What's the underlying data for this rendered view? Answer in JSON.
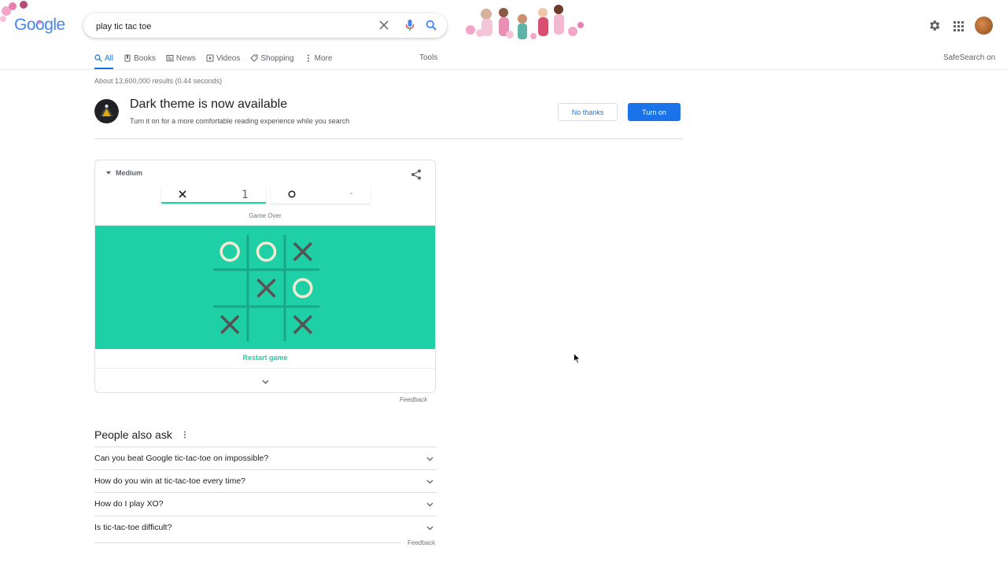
{
  "logo": {
    "text": "Google"
  },
  "search": {
    "query": "play tic tac toe"
  },
  "tabs": [
    {
      "label": "All",
      "icon": "search-icon"
    },
    {
      "label": "Books",
      "icon": "book-icon"
    },
    {
      "label": "News",
      "icon": "news-icon"
    },
    {
      "label": "Videos",
      "icon": "video-icon"
    },
    {
      "label": "Shopping",
      "icon": "tag-icon"
    },
    {
      "label": "More",
      "icon": "more-vert-icon"
    }
  ],
  "toolbar": {
    "tools_label": "Tools",
    "safesearch_label": "SafeSearch on"
  },
  "result_stats": "About 13,600,000 results (0.44 seconds)",
  "promo": {
    "title": "Dark theme is now available",
    "subtitle": "Turn it on for a more comfortable reading experience while you search",
    "no_thanks_label": "No thanks",
    "turn_on_label": "Turn on"
  },
  "game": {
    "difficulty": "Medium",
    "score_x": "1",
    "score_o": "-",
    "status": "Game Over",
    "board": [
      "O",
      "O",
      "X",
      "",
      "X",
      "O",
      "X",
      "",
      "X"
    ],
    "restart_label": "Restart game",
    "colors": {
      "board": "#1fcfa6",
      "x": "#545454",
      "o": "#f2ebd3"
    }
  },
  "feedback_label": "Feedback",
  "people_also_ask": {
    "title": "People also ask",
    "questions": [
      "Can you beat Google tic-tac-toe on impossible?",
      "How do you win at tic-tac-toe every time?",
      "How do I play XO?",
      "Is tic-tac-toe difficult?"
    ],
    "feedback_label": "Feedback"
  }
}
